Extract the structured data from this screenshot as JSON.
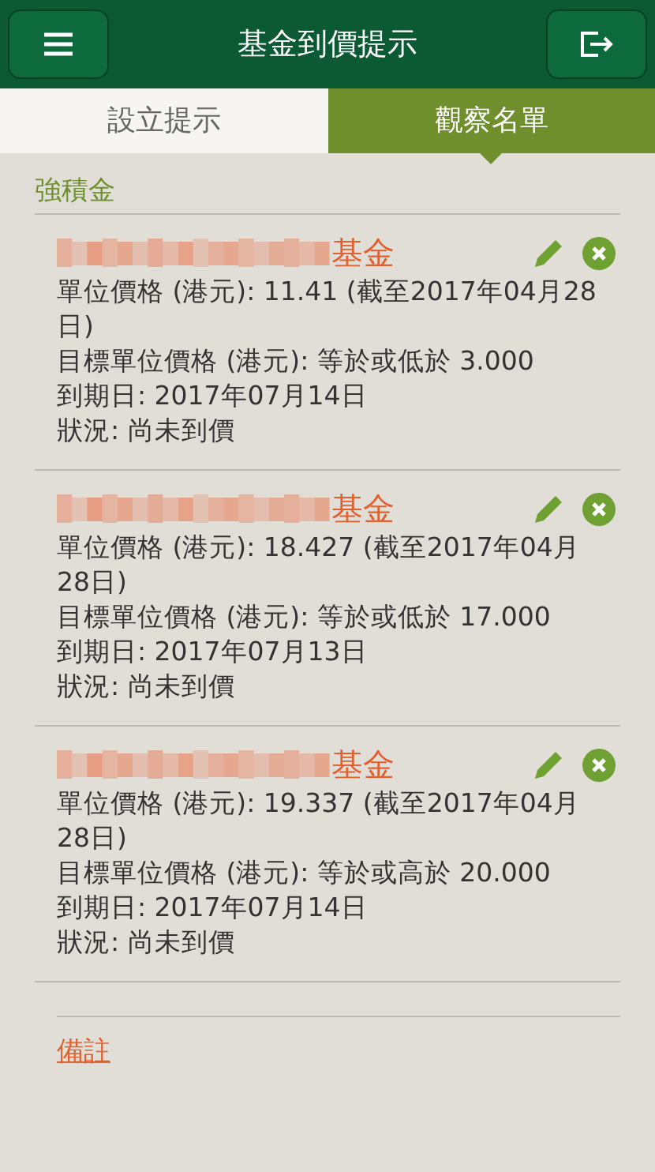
{
  "header": {
    "title": "基金到價提示"
  },
  "tabs": [
    {
      "label": "設立提示",
      "selected": false
    },
    {
      "label": "觀察名單",
      "selected": true
    }
  ],
  "section": {
    "title": "強積金"
  },
  "funds": [
    {
      "name": "基金",
      "lines": [
        "單位價格 (港元): 11.41 (截至2017年04月28日)",
        "目標單位價格 (港元): 等於或低於 3.000",
        "到期日: 2017年07月14日",
        "狀況: 尚未到價"
      ]
    },
    {
      "name": "基金",
      "lines": [
        "單位價格 (港元): 18.427 (截至2017年04月28日)",
        "目標單位價格 (港元): 等於或低於 17.000",
        "到期日: 2017年07月13日",
        "狀況: 尚未到價"
      ]
    },
    {
      "name": "基金",
      "lines": [
        "單位價格 (港元): 19.337 (截至2017年04月28日)",
        "目標單位價格 (港元): 等於或高於 20.000",
        "到期日: 2017年07月14日",
        "狀況: 尚未到價"
      ]
    }
  ],
  "remarks_link": "備註"
}
